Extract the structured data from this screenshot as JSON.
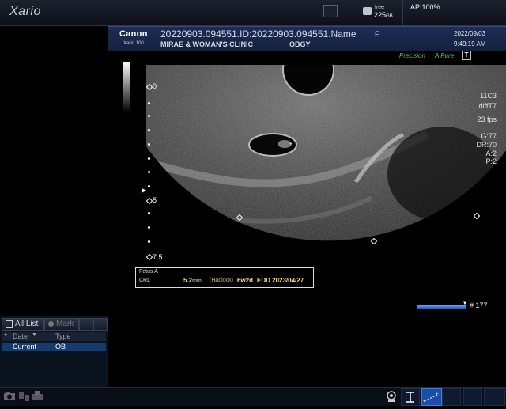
{
  "system": {
    "brand": "Xario",
    "storage_free_label": "free",
    "storage_size": "225",
    "storage_unit": "GB",
    "ap": "AP:100%"
  },
  "header": {
    "maker": "Canon",
    "model": "Xario 100",
    "patient_id": "20220903.094551.ID:20220903.094551.Name",
    "sex": "F",
    "clinic": "MIRAE & WOMAN'S CLINIC",
    "department": "OBGY",
    "date": "2022/09/03",
    "time": "9:49:19 AM"
  },
  "image_tags": {
    "precision": "Precision",
    "apure": "A Pure",
    "t_button": "T"
  },
  "probe_info": {
    "probe": "11C3",
    "mode": "diffT7",
    "fps": "23 fps",
    "gain": "G:77",
    "dynamic_range": "DR:70",
    "a": "A:2",
    "p": "P:2"
  },
  "depth": {
    "label_0": "0",
    "label_5": "5",
    "label_75": "7.5"
  },
  "measurement": {
    "title": "Fetus A",
    "name": "CRL",
    "value": "5.2",
    "unit": "mm",
    "method": "(Hadlock)",
    "ga": "6w2d",
    "edd": "EDD 2023/04/27"
  },
  "cine": {
    "count": "# 177",
    "progress": 1.0
  },
  "list_panel": {
    "tab_all": "All List",
    "tab_mark": "Mark",
    "col_date": "Date",
    "col_sort": "▼",
    "col_type": "Type",
    "row_date": "Current",
    "row_type": "OB"
  },
  "colors": {
    "header_bg": "#1c2c56",
    "accent_green": "#57c08c",
    "measure_yellow": "#ffe27a",
    "selected_row": "#143d6e",
    "active_tool": "#1a4fa5"
  }
}
